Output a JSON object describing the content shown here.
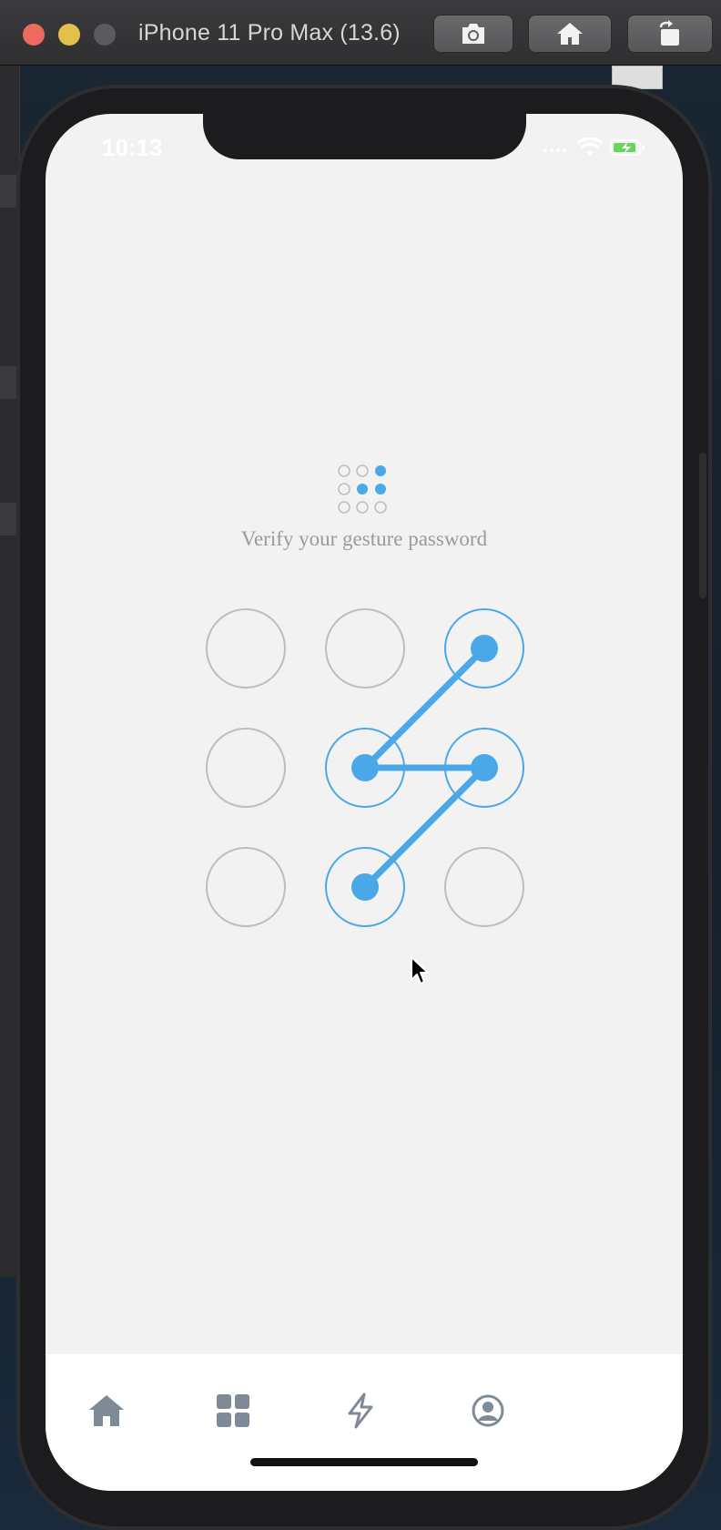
{
  "window": {
    "title": "iPhone 11 Pro Max (13.6)",
    "toolbar": [
      {
        "name": "screenshot",
        "icon": "camera-icon"
      },
      {
        "name": "home",
        "icon": "home-icon"
      },
      {
        "name": "rotate",
        "icon": "rotate-icon"
      }
    ]
  },
  "status_bar": {
    "time": "10:13",
    "icons": [
      "signal-icon",
      "wifi-icon",
      "battery-charging-icon"
    ]
  },
  "gesture_lock": {
    "prompt": "Verify your gesture password",
    "grid_size": 3,
    "selected_sequence": [
      2,
      4,
      5,
      7
    ],
    "colors": {
      "accent": "#4aa8e8",
      "idle_ring": "#bdbdbd",
      "background": "#f2f2f2"
    }
  },
  "tab_bar": {
    "items": [
      {
        "name": "home",
        "icon": "home-icon"
      },
      {
        "name": "apps",
        "icon": "grid-icon"
      },
      {
        "name": "activity",
        "icon": "lightning-icon"
      },
      {
        "name": "profile",
        "icon": "user-icon"
      }
    ],
    "icon_color": "#7f8a98"
  }
}
